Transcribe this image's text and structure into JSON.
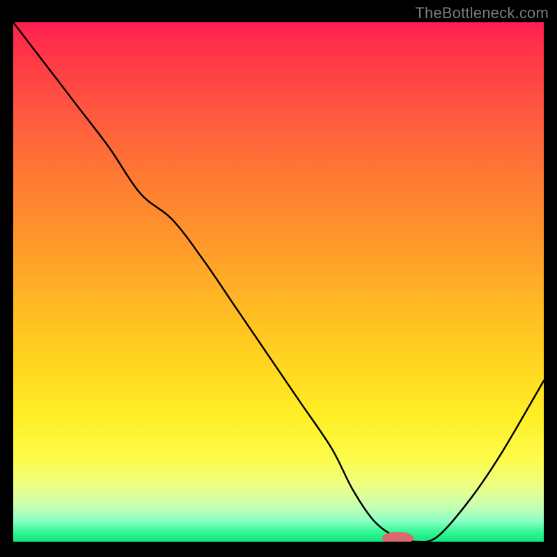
{
  "watermark": "TheBottleneck.com",
  "chart_data": {
    "type": "line",
    "title": "",
    "xlabel": "",
    "ylabel": "",
    "xlim": [
      0,
      100
    ],
    "ylim": [
      0,
      100
    ],
    "grid": false,
    "series": [
      {
        "name": "bottleneck-curve",
        "x": [
          0,
          6,
          12,
          18,
          24,
          30,
          36,
          42,
          48,
          54,
          60,
          64,
          68,
          72,
          76,
          80,
          86,
          92,
          100
        ],
        "y": [
          100,
          92,
          84,
          76,
          67,
          62,
          54,
          45,
          36,
          27,
          18,
          10,
          4,
          1,
          0,
          1,
          8,
          17,
          31
        ]
      }
    ],
    "marker": {
      "name": "optimal-point",
      "x": 72.5,
      "y": 0.7,
      "rx": 3.0,
      "ry": 1.2
    },
    "background": "rainbow-vertical-gradient"
  }
}
